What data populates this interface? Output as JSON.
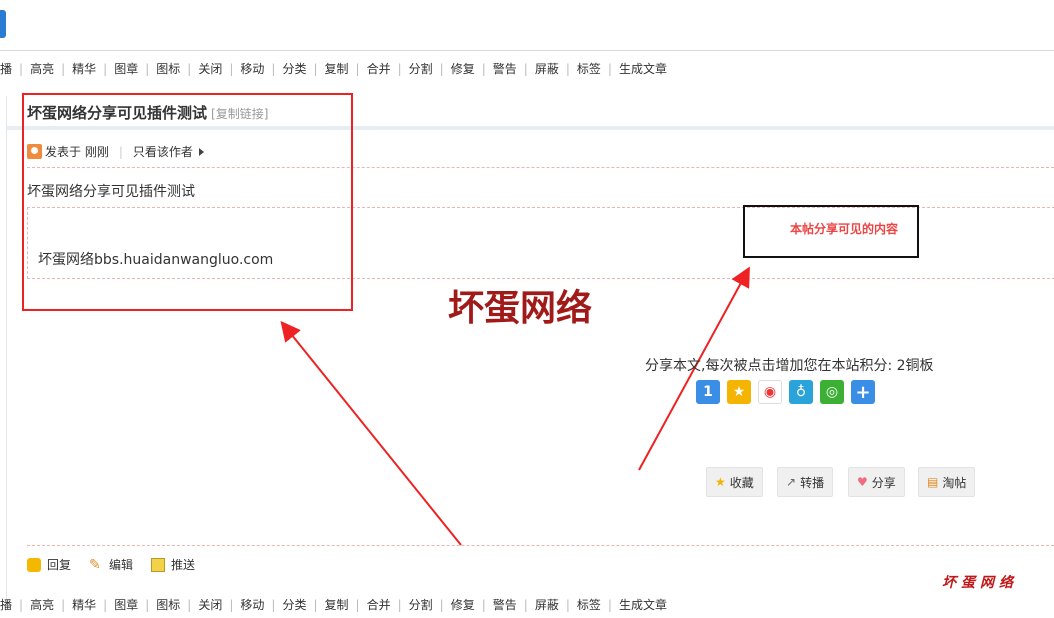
{
  "mod_actions": [
    "播",
    "高亮",
    "精华",
    "图章",
    "图标",
    "关闭",
    "移动",
    "分类",
    "复制",
    "合并",
    "分割",
    "修复",
    "警告",
    "屏蔽",
    "标签",
    "生成文章"
  ],
  "thread": {
    "title": "坏蛋网络分享可见插件测试",
    "copy_link": "[复制链接]",
    "posted": "发表于 刚刚",
    "only_author": "只看该作者",
    "body": "坏蛋网络分享可见插件测试",
    "hidden_content": "坏蛋网络bbs.huaidanwangluo.com"
  },
  "share_visible_label": "本帖分享可见的内容",
  "watermark": "坏蛋网络",
  "share_promo": "分享本文,每次被点击增加您在本站积分: 2铜板",
  "share_icons": [
    "qq-zone-icon",
    "favorite-star-icon",
    "weibo-icon",
    "tencent-weibo-icon",
    "wechat-icon",
    "more-plus-icon"
  ],
  "post_actions": {
    "favorite": "收藏",
    "repost": "转播",
    "share": "分享",
    "taotie": "淘帖"
  },
  "footer_actions": {
    "reply": "回复",
    "edit": "编辑",
    "push": "推送"
  },
  "bottom_watermark": "坏蛋网络",
  "colors": {
    "annotation_red": "#e22222",
    "watermark_red": "#a11a1a",
    "share_label_red": "#e44444"
  }
}
